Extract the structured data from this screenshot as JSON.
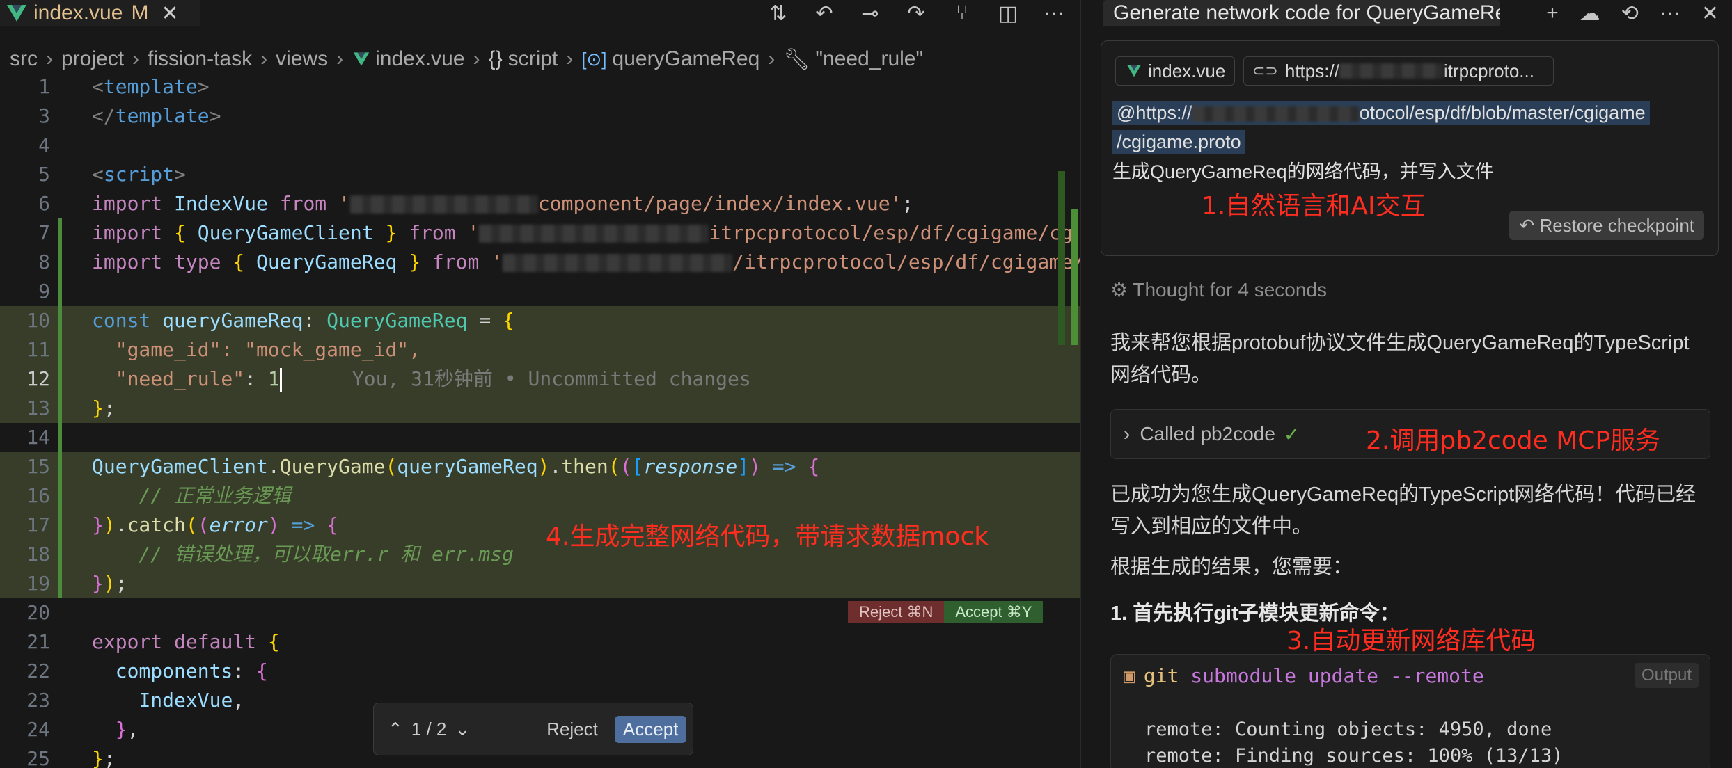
{
  "editor": {
    "tab": {
      "filename": "index.vue",
      "modified": "M",
      "close": "✕"
    },
    "toolbar_icons": [
      "git-compare-icon",
      "go-back-icon",
      "commit-icon",
      "go-forward-icon",
      "source-control-icon",
      "split-editor-icon",
      "more-icon"
    ],
    "breadcrumb": [
      "src",
      "project",
      "fission-task",
      "views",
      "index.vue",
      "script",
      "queryGameReq",
      "\"need_rule\""
    ],
    "blame": "You, 31秒钟前 • Uncommitted changes",
    "diff_buttons": {
      "reject": "Reject ⌘N",
      "accept": "Accept ⌘Y"
    },
    "float_bar": {
      "nav": "1 / 2",
      "reject": "Reject",
      "accept": "Accept"
    },
    "annotation": "4.生成完整网络代码，带请求数据mock",
    "line_numbers": [
      "1",
      "3",
      "4",
      "5",
      "6",
      "7",
      "8",
      "9",
      "10",
      "11",
      "12",
      "13",
      "14",
      "15",
      "16",
      "17",
      "18",
      "19",
      "20",
      "21",
      "22",
      "23",
      "24",
      "25"
    ],
    "code": {
      "l1": "<template>",
      "l3": "</template>",
      "l5": "<script>",
      "l6a": "import IndexVue from '",
      "l6b": "component/page/index/index.vue';",
      "l7a": "import { QueryGameClient } from '",
      "l7b": "itrpcprotocol/esp/df/cgigame/cg",
      "l8a": "import type { QueryGameReq } from '",
      "l8b": "/itrpcprotocol/esp/df/cgigame/",
      "l11": "\"game_id\": \"mock_game_id\",",
      "l12key": "\"need_rule\"",
      "l12val": "1",
      "l16": "// 正常业务逻辑",
      "l18": "// 错误处理，可以取err.r 和 err.msg"
    }
  },
  "chat": {
    "title": "Generate network code for QueryGameReq",
    "header_icons": [
      "plus-icon",
      "cloud-icon",
      "history-icon",
      "more-icon",
      "close-icon"
    ],
    "chip_file": "index.vue",
    "chip_url": "https://",
    "chip_url_tail": "itrpcproto...",
    "mention_a": "@https://",
    "mention_b": "otocol/esp/df/blob/master/cgigame",
    "mention_c": "/cgigame.proto",
    "prompt": "生成QueryGameReq的网络代码，并写入文件",
    "annotation1": "1.自然语言和AI交互",
    "restore": "Restore checkpoint",
    "thought": "Thought for 4 seconds",
    "para1": "我来帮您根据protobuf协议文件生成QueryGameReq的TypeScript网络代码。",
    "called": "Called pb2code",
    "annotation2": "2.调用pb2code MCP服务",
    "para2": "已成功为您生成QueryGameReq的TypeScript网络代码！代码已经写入到相应的文件中。",
    "para3": "根据生成的结果，您需要：",
    "step1": "1. 首先执行git子模块更新命令：",
    "annotation3": "3.自动更新网络库代码",
    "terminal": {
      "cmd_git": "git",
      "cmd_rest": "submodule update --remote",
      "output_btn": "Output",
      "out1": "remote: Counting objects: 4950, done",
      "out2": "remote: Finding sources: 100% (13/13)"
    }
  }
}
